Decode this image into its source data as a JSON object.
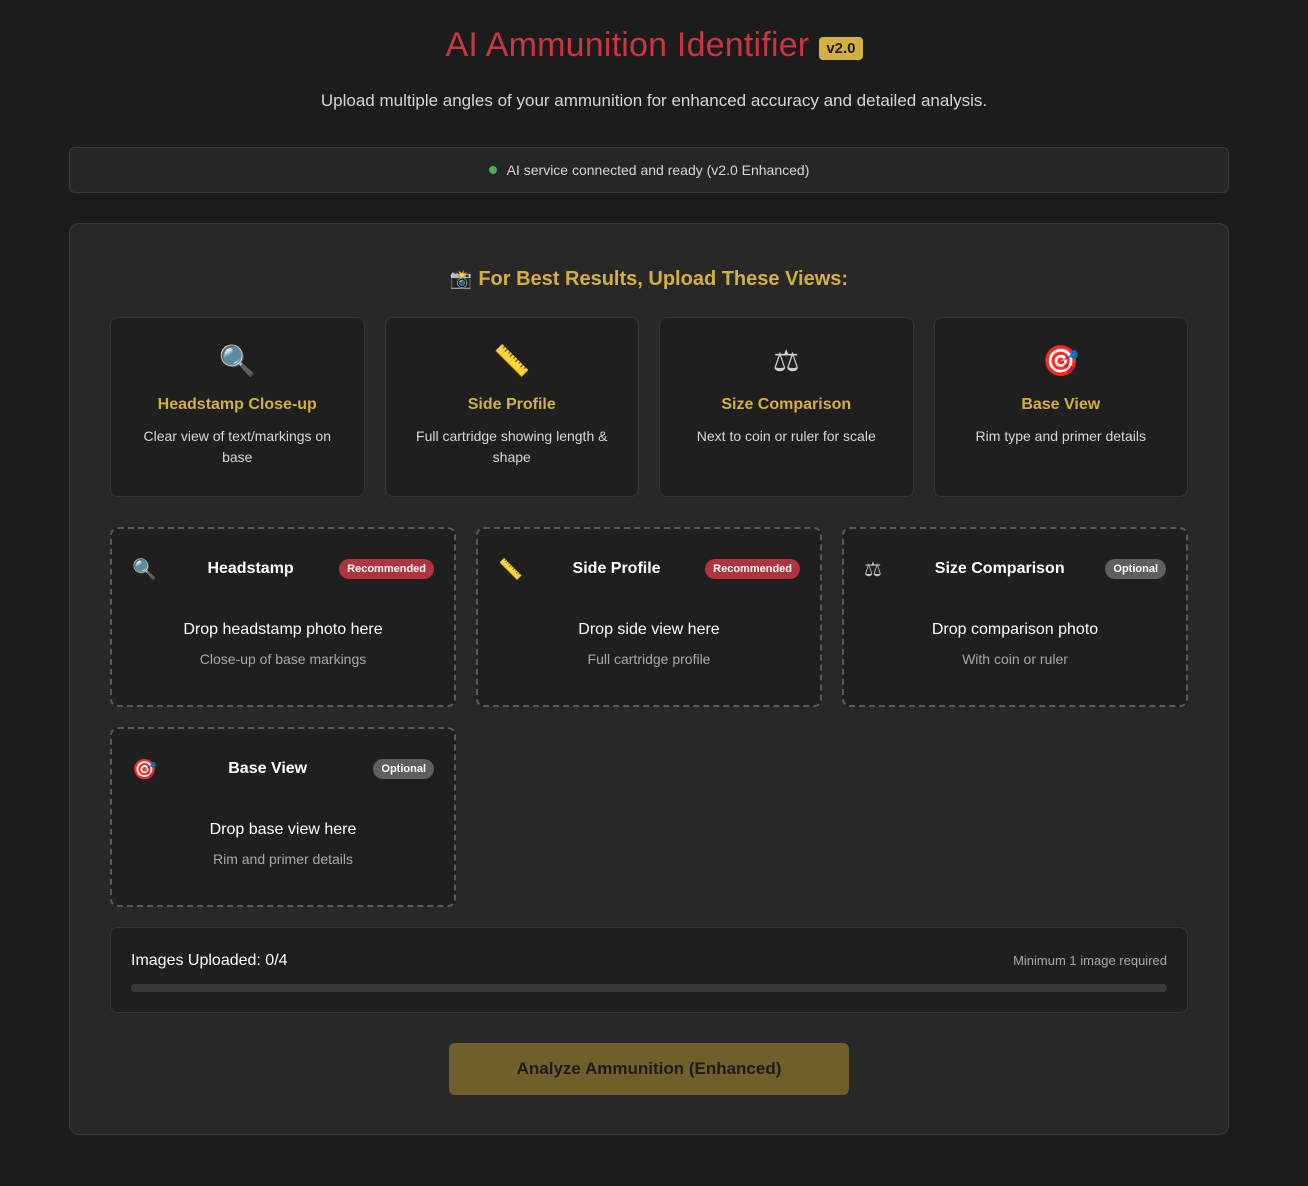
{
  "header": {
    "title": "AI Ammunition Identifier",
    "version": "v2.0",
    "subtitle": "Upload multiple angles of your ammunition for enhanced accuracy and detailed analysis."
  },
  "status": {
    "text": "AI service connected and ready (v2.0 Enhanced)",
    "color": "#4caf50"
  },
  "tips": {
    "heading": "For Best Results, Upload These Views:",
    "heading_icon": "camera-flash-icon",
    "items": [
      {
        "icon": "magnifier-icon",
        "glyph": "🔍",
        "title": "Headstamp Close-up",
        "desc": "Clear view of text/markings on base"
      },
      {
        "icon": "ruler-icon",
        "glyph": "📏",
        "title": "Side Profile",
        "desc": "Full cartridge showing length & shape"
      },
      {
        "icon": "scales-icon",
        "glyph": "⚖",
        "title": "Size Comparison",
        "desc": "Next to coin or ruler for scale"
      },
      {
        "icon": "target-icon",
        "glyph": "🎯",
        "title": "Base View",
        "desc": "Rim type and primer details"
      }
    ]
  },
  "zones": [
    {
      "icon": "magnifier-icon",
      "glyph": "🔍",
      "title": "Headstamp",
      "badge": "Recommended",
      "drop": "Drop headstamp photo here",
      "sub": "Close-up of base markings"
    },
    {
      "icon": "ruler-icon",
      "glyph": "📏",
      "title": "Side Profile",
      "badge": "Recommended",
      "drop": "Drop side view here",
      "sub": "Full cartridge profile"
    },
    {
      "icon": "scales-icon",
      "glyph": "⚖",
      "title": "Size Comparison",
      "badge": "Optional",
      "drop": "Drop comparison photo",
      "sub": "With coin or ruler"
    },
    {
      "icon": "target-icon",
      "glyph": "🎯",
      "title": "Base View",
      "badge": "Optional",
      "drop": "Drop base view here",
      "sub": "Rim and primer details"
    }
  ],
  "progress": {
    "label": "Images Uploaded: 0/4",
    "min_note": "Minimum 1 image required",
    "fraction": 0
  },
  "analyze_button": "Analyze Ammunition (Enhanced)",
  "colors": {
    "accent": "#d4b040",
    "title": "#c8363e",
    "recommended": "#b3333d",
    "optional": "#5f5f5f"
  }
}
